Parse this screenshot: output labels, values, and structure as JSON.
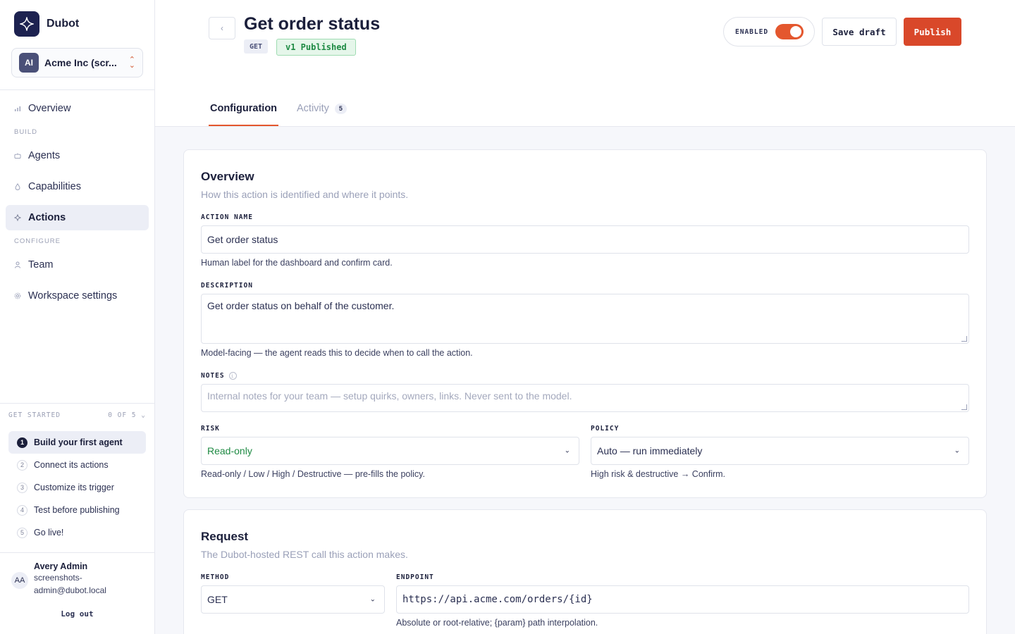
{
  "brand": {
    "name": "Dubot"
  },
  "workspace": {
    "initials": "AI",
    "name": "Acme Inc (scr..."
  },
  "nav": {
    "overview": "Overview",
    "build_label": "BUILD",
    "agents": "Agents",
    "capabilities": "Capabilities",
    "actions": "Actions",
    "configure_label": "CONFIGURE",
    "team": "Team",
    "workspace_settings": "Workspace settings"
  },
  "get_started": {
    "label": "GET STARTED",
    "progress": "0 OF 5",
    "steps": [
      {
        "num": "1",
        "label": "Build your first agent"
      },
      {
        "num": "2",
        "label": "Connect its actions"
      },
      {
        "num": "3",
        "label": "Customize its trigger"
      },
      {
        "num": "4",
        "label": "Test before publishing"
      },
      {
        "num": "5",
        "label": "Go live!"
      }
    ]
  },
  "user": {
    "initials": "AA",
    "name": "Avery Admin",
    "email": "screenshots-admin@dubot.local",
    "logout": "Log out"
  },
  "header": {
    "title": "Get order status",
    "method_badge": "GET",
    "version_badge": "v1 Published",
    "enabled_label": "ENABLED",
    "enabled": true,
    "save_draft": "Save draft",
    "publish": "Publish"
  },
  "tabs": {
    "configuration": "Configuration",
    "activity": "Activity",
    "activity_count": "5"
  },
  "overview_card": {
    "title": "Overview",
    "subtitle": "How this action is identified and where it points.",
    "action_name_label": "ACTION NAME",
    "action_name_value": "Get order status",
    "action_name_help": "Human label for the dashboard and confirm card.",
    "description_label": "DESCRIPTION",
    "description_value": "Get order status on behalf of the customer.",
    "description_help": "Model-facing — the agent reads this to decide when to call the action.",
    "notes_label": "NOTES",
    "notes_placeholder": "Internal notes for your team — setup quirks, owners, links. Never sent to the model.",
    "risk_label": "RISK",
    "risk_value": "Read-only",
    "risk_help": "Read-only / Low / High / Destructive — pre-fills the policy.",
    "policy_label": "POLICY",
    "policy_value": "Auto — run immediately",
    "policy_help": "High risk & destructive → Confirm."
  },
  "request_card": {
    "title": "Request",
    "subtitle": "The Dubot-hosted REST call this action makes.",
    "method_label": "METHOD",
    "method_value": "GET",
    "endpoint_label": "ENDPOINT",
    "endpoint_value": "https://api.acme.com/orders/{id}",
    "endpoint_help": "Absolute or root-relative; {param} path interpolation."
  },
  "colors": {
    "accent": "#e4572e",
    "publish": "#d9482a",
    "brand_dark": "#1d2250",
    "published_green": "#1e8a43"
  }
}
